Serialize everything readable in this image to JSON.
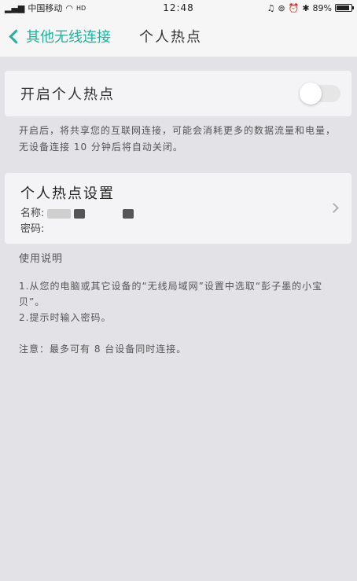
{
  "status_bar": {
    "carrier": "中国移动",
    "time": "12:48",
    "battery": "89%",
    "battery_level": 0.89
  },
  "nav": {
    "back_label": "其他无线连接",
    "title": "个人热点"
  },
  "hotspot_toggle": {
    "label": "开启个人热点",
    "enabled": false
  },
  "hotspot_note": "开启后，将共享您的互联网连接，可能会消耗更多的数据流量和电量，无设备连接 10 分钟后将自动关闭。",
  "settings": {
    "title": "个人热点设置",
    "name_label": "名称:",
    "password_label": "密码:"
  },
  "instructions": {
    "heading": "使用说明",
    "step1": "1.从您的电脑或其它设备的“无线局域网”设置中选取“彭子墨的小宝贝”。",
    "step2": "2.提示时输入密码。",
    "note": "注意：最多可有 8 台设备同时连接。"
  },
  "colors": {
    "accent": "#24b09a",
    "background": "#e3e2e7"
  }
}
